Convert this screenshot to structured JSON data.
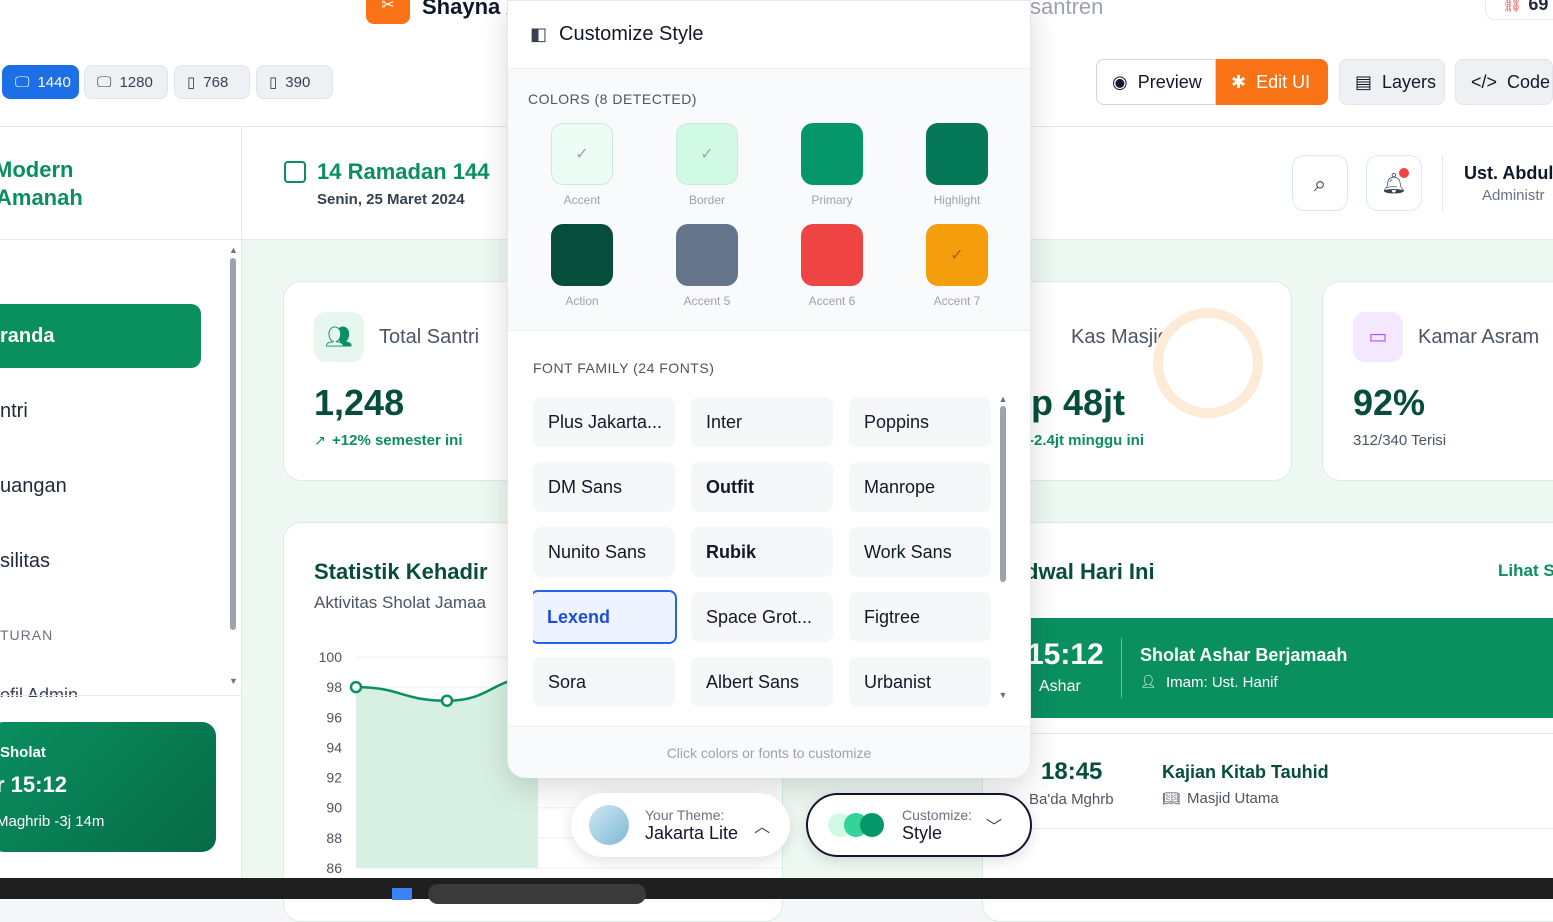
{
  "header": {
    "brand": "Shayna /",
    "crumb": "santren",
    "badge_count": "69",
    "devices": [
      {
        "label": "1440",
        "active": true
      },
      {
        "label": "1280"
      },
      {
        "label": "768"
      },
      {
        "label": "390"
      }
    ],
    "actions": {
      "preview": "Preview",
      "edit": "Edit UI",
      "layers": "Layers",
      "code": "Code"
    }
  },
  "sidebar": {
    "brand_line1": "Modern",
    "brand_line2": "Amanah",
    "items": [
      "randa",
      "ntri",
      "uangan",
      "silitas"
    ],
    "section": "TURAN",
    "profile": "ofil Admin",
    "prayer": {
      "label": "Sholat",
      "time": "r 15:12",
      "next": "Maghrib -3j 14m"
    }
  },
  "main": {
    "date": "14 Ramadan 144",
    "weekday": "Senin, 25 Maret 2024",
    "user_name": "Ust. Abdul",
    "user_role": "Administr",
    "stats": {
      "santri": {
        "label": "Total Santri",
        "value": "1,248",
        "delta": "+12% semester ini"
      },
      "kas": {
        "label": "Kas Masjid",
        "value": "p 48jt",
        "delta": "-2.4jt minggu ini"
      },
      "kamar": {
        "label": "Kamar Asram",
        "value": "92%",
        "delta": "312/340 Terisi"
      }
    },
    "chart_card": {
      "title": "Statistik Kehadir",
      "subtitle": "Aktivitas Sholat Jamaa"
    },
    "schedule": {
      "title": "dwal Hari Ini",
      "link": "Lihat S",
      "items": [
        {
          "time": "15:12",
          "period": "Ashar",
          "title": "Sholat Ashar Berjamaah",
          "meta": "Imam: Ust. Hanif",
          "highlight": true
        },
        {
          "time": "18:45",
          "period": "Ba'da Mghrb",
          "title": "Kajian Kitab Tauhid",
          "meta": "Masjid Utama"
        }
      ]
    }
  },
  "chart_data": {
    "type": "line",
    "title": "",
    "x": [
      0,
      1,
      2
    ],
    "series": [
      {
        "values": [
          98,
          97.1,
          98.7
        ]
      }
    ],
    "yticks": [
      "100",
      "98",
      "96",
      "94",
      "92",
      "90",
      "88",
      "86"
    ],
    "ylim": [
      86,
      100
    ],
    "grid": true
  },
  "customize": {
    "title": "Customize Style",
    "colors_heading": "COLORS (8 DETECTED)",
    "colors": [
      {
        "label": "Accent",
        "hex": "#ecfdf5",
        "check": true
      },
      {
        "label": "Border",
        "hex": "#d1fae5",
        "check": true
      },
      {
        "label": "Primary",
        "hex": "#059669"
      },
      {
        "label": "Highlight",
        "hex": "#047857"
      },
      {
        "label": "Action",
        "hex": "#064e3b"
      },
      {
        "label": "Accent 5",
        "hex": "#64748b"
      },
      {
        "label": "Accent 6",
        "hex": "#ef4444"
      },
      {
        "label": "Accent 7",
        "hex": "#f59e0b",
        "check": true
      }
    ],
    "fonts_heading": "FONT FAMILY (24 FONTS)",
    "fonts": [
      "Plus Jakarta...",
      "Inter",
      "Poppins",
      "DM Sans",
      "Outfit",
      "Manrope",
      "Nunito Sans",
      "Rubik",
      "Work Sans",
      "Lexend",
      "Space Grot...",
      "Figtree",
      "Sora",
      "Albert Sans",
      "Urbanist"
    ],
    "selected_font": "Lexend",
    "footer": "Click colors or fonts to customize"
  },
  "theme_pill": {
    "label": "Your Theme:",
    "value": "Jakarta Lite"
  },
  "customize_pill": {
    "label": "Customize:",
    "value": "Style"
  },
  "colors": {
    "brand_green": "#0a8f5f",
    "orange": "#f97316",
    "blue": "#1d6fe8"
  }
}
